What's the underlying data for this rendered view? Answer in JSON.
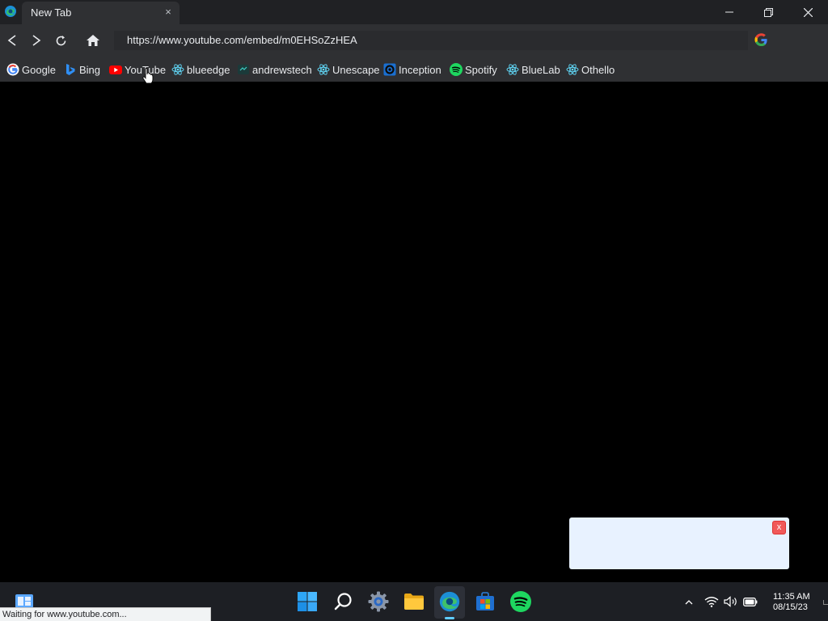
{
  "window": {
    "tab_title": "New Tab",
    "tab_close": "×"
  },
  "toolbar": {
    "url": "https://www.youtube.com/embed/m0EHSoZzHEA"
  },
  "bookmarks": [
    {
      "label": "Google",
      "icon": "google-icon"
    },
    {
      "label": "Bing",
      "icon": "bing-icon"
    },
    {
      "label": "YouTube",
      "icon": "youtube-icon"
    },
    {
      "label": "blueedge",
      "icon": "react-icon"
    },
    {
      "label": "andrewstech",
      "icon": "andrewstech-icon"
    },
    {
      "label": "Unescape",
      "icon": "react-icon"
    },
    {
      "label": "Inception",
      "icon": "inception-icon"
    },
    {
      "label": "Spotify",
      "icon": "spotify-icon"
    },
    {
      "label": "BlueLab",
      "icon": "react-icon"
    },
    {
      "label": "Othello",
      "icon": "react-icon"
    }
  ],
  "toast": {
    "close_label": "x"
  },
  "status_bar": {
    "text": "Waiting for www.youtube.com..."
  },
  "taskbar": {
    "time": "11:35 AM",
    "date": "08/15/23"
  },
  "colors": {
    "frame": "#202124",
    "toolbar": "#2f3033",
    "toast_bg": "#e8f2ff",
    "toast_close": "#f15959",
    "taskbar": "#1d1f24",
    "accent": "#60cdff",
    "spotify": "#1ed760"
  }
}
